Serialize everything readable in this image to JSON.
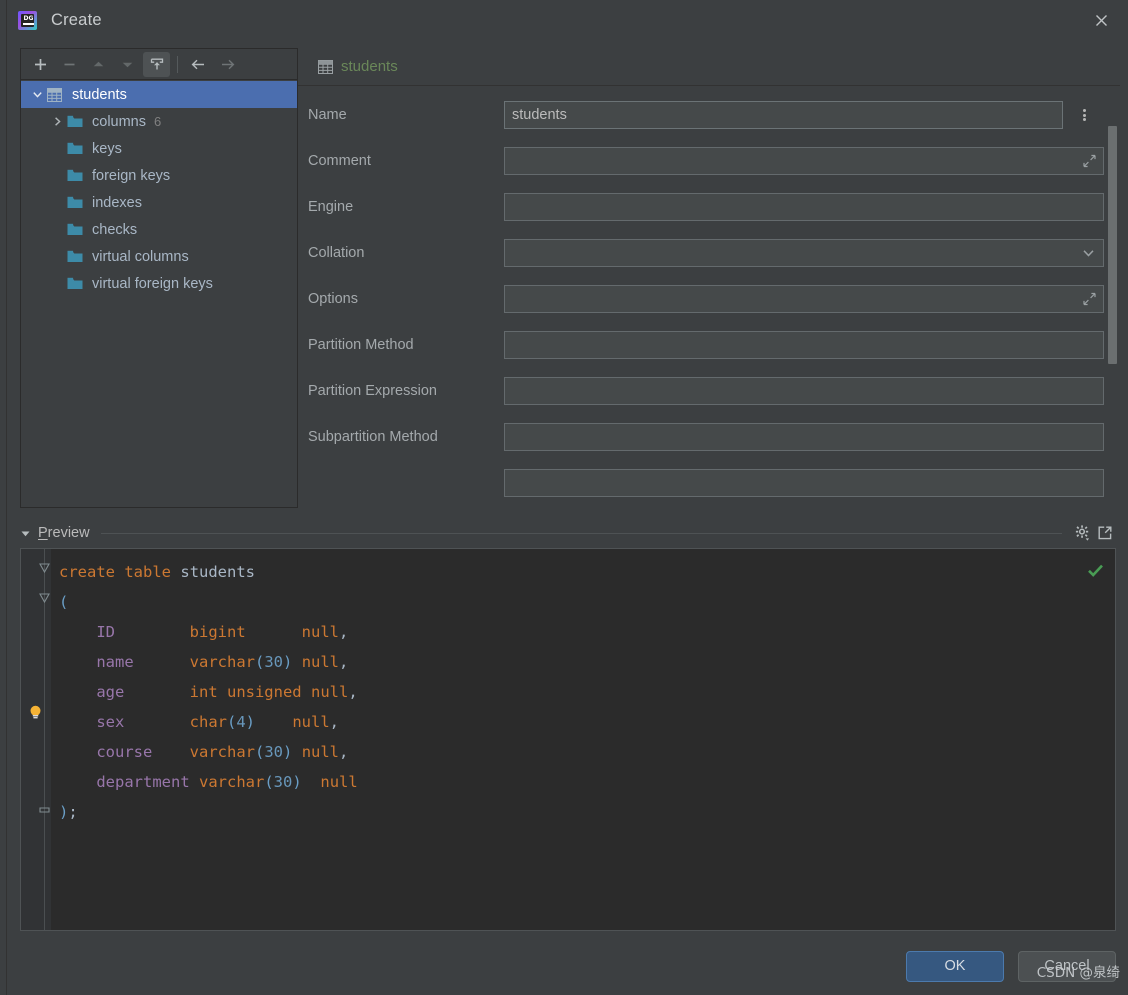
{
  "window": {
    "title": "Create",
    "logo_icon": "datagrip-logo-icon",
    "close_icon": "close-icon"
  },
  "tree": {
    "toolbar": [
      {
        "name": "add-button",
        "icon": "plus-icon",
        "enabled": true,
        "active": false
      },
      {
        "name": "remove-button",
        "icon": "minus-icon",
        "enabled": false,
        "active": false
      },
      {
        "name": "move-up-button",
        "icon": "chevron-up-icon",
        "enabled": false,
        "active": false
      },
      {
        "name": "move-down-button",
        "icon": "chevron-down-icon",
        "enabled": false,
        "active": false
      },
      {
        "name": "restore-button",
        "icon": "upload-box-icon",
        "enabled": true,
        "active": true
      },
      {
        "name": "back-button",
        "icon": "arrow-left-icon",
        "enabled": true,
        "active": false
      },
      {
        "name": "forward-button",
        "icon": "arrow-right-icon",
        "enabled": false,
        "active": false
      }
    ],
    "items": [
      {
        "label": "students",
        "icon": "table-icon",
        "arrow": "expanded",
        "level": 0,
        "selected": true,
        "count": ""
      },
      {
        "label": "columns",
        "icon": "folder-icon",
        "arrow": "collapsed",
        "level": 1,
        "selected": false,
        "count": "6"
      },
      {
        "label": "keys",
        "icon": "folder-icon",
        "arrow": "none",
        "level": 1,
        "selected": false,
        "count": ""
      },
      {
        "label": "foreign keys",
        "icon": "folder-icon",
        "arrow": "none",
        "level": 1,
        "selected": false,
        "count": ""
      },
      {
        "label": "indexes",
        "icon": "folder-icon",
        "arrow": "none",
        "level": 1,
        "selected": false,
        "count": ""
      },
      {
        "label": "checks",
        "icon": "folder-icon",
        "arrow": "none",
        "level": 1,
        "selected": false,
        "count": ""
      },
      {
        "label": "virtual columns",
        "icon": "folder-icon",
        "arrow": "none",
        "level": 1,
        "selected": false,
        "count": ""
      },
      {
        "label": "virtual foreign keys",
        "icon": "folder-icon",
        "arrow": "none",
        "level": 1,
        "selected": false,
        "count": ""
      }
    ]
  },
  "form": {
    "header_title": "students",
    "header_icon": "table-icon",
    "name_menu_icon": "more-vertical-icon",
    "fields": [
      {
        "label": "Name",
        "value": "students",
        "placeholder": "",
        "kind": "text-with-menu",
        "icon": ""
      },
      {
        "label": "Comment",
        "value": "",
        "placeholder": "",
        "kind": "text-expand",
        "icon": "expand-diagonal-icon"
      },
      {
        "label": "Engine",
        "value": "",
        "placeholder": "",
        "kind": "text",
        "icon": ""
      },
      {
        "label": "Collation",
        "value": "",
        "placeholder": "",
        "kind": "combo",
        "icon": "chevron-down-icon"
      },
      {
        "label": "Options",
        "value": "",
        "placeholder": "",
        "kind": "text-expand",
        "icon": "expand-diagonal-icon"
      },
      {
        "label": "Partition Method",
        "value": "",
        "placeholder": "",
        "kind": "text",
        "icon": ""
      },
      {
        "label": "Partition Expression",
        "value": "",
        "placeholder": "",
        "kind": "text",
        "icon": ""
      },
      {
        "label": "Subpartition Method",
        "value": "",
        "placeholder": "",
        "kind": "text",
        "icon": ""
      }
    ]
  },
  "preview": {
    "title_prefix": "P",
    "title_rest": "review",
    "caret_icon": "triangle-down-icon",
    "settings_icon": "gear-dropdown-icon",
    "popout_icon": "open-external-icon",
    "status_icon": "checkmark-icon",
    "bulb_icon": "lightbulb-icon",
    "sql_lines": [
      [
        {
          "t": "create",
          "c": "kw"
        },
        {
          "t": " ",
          "c": "punc"
        },
        {
          "t": "table",
          "c": "kw"
        },
        {
          "t": " ",
          "c": "punc"
        },
        {
          "t": "students",
          "c": "tbl"
        }
      ],
      [
        {
          "t": "(",
          "c": "paren"
        }
      ],
      [
        {
          "t": "    ",
          "c": "punc"
        },
        {
          "t": "ID        ",
          "c": "col"
        },
        {
          "t": "bigint",
          "c": "kw"
        },
        {
          "t": "      ",
          "c": "punc"
        },
        {
          "t": "null",
          "c": "kw"
        },
        {
          "t": ",",
          "c": "punc"
        }
      ],
      [
        {
          "t": "    ",
          "c": "punc"
        },
        {
          "t": "name      ",
          "c": "col"
        },
        {
          "t": "varchar",
          "c": "kw"
        },
        {
          "t": "(",
          "c": "paren"
        },
        {
          "t": "30",
          "c": "num"
        },
        {
          "t": ")",
          "c": "paren"
        },
        {
          "t": " ",
          "c": "punc"
        },
        {
          "t": "null",
          "c": "kw"
        },
        {
          "t": ",",
          "c": "punc"
        }
      ],
      [
        {
          "t": "    ",
          "c": "punc"
        },
        {
          "t": "age       ",
          "c": "col"
        },
        {
          "t": "int unsigned",
          "c": "kw"
        },
        {
          "t": " ",
          "c": "punc"
        },
        {
          "t": "null",
          "c": "kw"
        },
        {
          "t": ",",
          "c": "punc"
        }
      ],
      [
        {
          "t": "    ",
          "c": "punc"
        },
        {
          "t": "sex       ",
          "c": "col"
        },
        {
          "t": "char",
          "c": "kw"
        },
        {
          "t": "(",
          "c": "paren"
        },
        {
          "t": "4",
          "c": "num"
        },
        {
          "t": ")",
          "c": "paren"
        },
        {
          "t": "    ",
          "c": "punc"
        },
        {
          "t": "null",
          "c": "kw"
        },
        {
          "t": ",",
          "c": "punc"
        }
      ],
      [
        {
          "t": "    ",
          "c": "punc"
        },
        {
          "t": "course    ",
          "c": "col"
        },
        {
          "t": "varchar",
          "c": "kw"
        },
        {
          "t": "(",
          "c": "paren"
        },
        {
          "t": "30",
          "c": "num"
        },
        {
          "t": ")",
          "c": "paren"
        },
        {
          "t": " ",
          "c": "punc"
        },
        {
          "t": "null",
          "c": "kw"
        },
        {
          "t": ",",
          "c": "punc"
        }
      ],
      [
        {
          "t": "    ",
          "c": "punc"
        },
        {
          "t": "department",
          "c": "col"
        },
        {
          "t": " ",
          "c": "punc"
        },
        {
          "t": "varchar",
          "c": "kw"
        },
        {
          "t": "(",
          "c": "paren"
        },
        {
          "t": "30",
          "c": "num"
        },
        {
          "t": ")",
          "c": "paren"
        },
        {
          "t": "  ",
          "c": "punc"
        },
        {
          "t": "null",
          "c": "kw"
        }
      ],
      [
        {
          "t": ")",
          "c": "paren"
        },
        {
          "t": ";",
          "c": "punc"
        }
      ]
    ]
  },
  "buttons": {
    "ok_label": "OK",
    "cancel_label": "Cancel"
  },
  "watermark": "CSDN @泉绮",
  "colors": {
    "dialog_bg": "#3c3f41",
    "editor_bg": "#2b2b2b",
    "selection_blue": "#4b6eaf",
    "ok_button_blue": "#365880",
    "folder_teal": "#3d8ba8",
    "header_green": "#6a8759",
    "keyword_orange": "#cc7832",
    "column_purple": "#9876aa",
    "number_blue": "#6897bb",
    "default_text": "#a9b7c6",
    "check_green": "#499c54",
    "bulb_yellow": "#ffae42"
  }
}
